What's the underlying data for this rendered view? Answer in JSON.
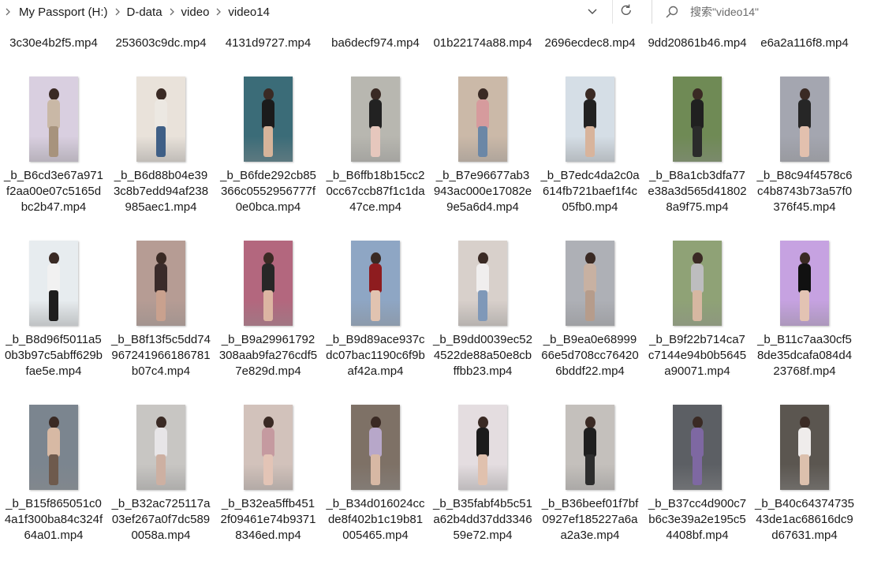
{
  "address_bar": {
    "crumbs": [
      "My Passport (H:)",
      "D-data",
      "video",
      "video14"
    ]
  },
  "search": {
    "placeholder": "搜索\"video14\""
  },
  "top_row": [
    "3c30e4b2f5.mp4",
    "253603c9dc.mp4",
    "4131d9727.mp4",
    "ba6decf974.mp4",
    "01b22174a88.mp4",
    "2696ecdec8.mp4",
    "9dd20861b46.mp4",
    "e6a2a116f8.mp4"
  ],
  "files": [
    {
      "name": "_b_B6cd3e67a971f2aa00e07c5165dbc2b47.mp4",
      "bg": "#d9cfe0",
      "body": "#c9b8a6",
      "legs": "#a7937d"
    },
    {
      "name": "_b_B6d88b04e393c8b7edd94af238985aec1.mp4",
      "bg": "#e9e2da",
      "body": "#ece8e2",
      "legs": "#3f5f86"
    },
    {
      "name": "_b_B6fde292cb85366c0552956777f0e0bca.mp4",
      "bg": "#3b6c78",
      "body": "#1b1b1b",
      "legs": "#d6b49a"
    },
    {
      "name": "_b_B6ffb18b15cc20cc67ccb87f1c1da47ce.mp4",
      "bg": "#b8b7b0",
      "body": "#222222",
      "legs": "#e6c7bd"
    },
    {
      "name": "_b_B7e96677ab3943ac000e17082e9e5a6d4.mp4",
      "bg": "#cbb9a8",
      "body": "#d69b9d",
      "legs": "#6b87a6"
    },
    {
      "name": "_b_B7edc4da2c0a614fb721baef1f4c05fb0.mp4",
      "bg": "#d5dee6",
      "body": "#222222",
      "legs": "#d8b49c"
    },
    {
      "name": "_b_B8a1cb3dfa77e38a3d565d418028a9f75.mp4",
      "bg": "#6f8a55",
      "body": "#202020",
      "legs": "#2b2b2b"
    },
    {
      "name": "_b_B8c94f4578c6c4b8743b73a57f0376f45.mp4",
      "bg": "#a4a6b0",
      "body": "#262626",
      "legs": "#e2c0ae"
    },
    {
      "name": "_b_B8d96f5011a50b3b97c5abff629bfae5e.mp4",
      "bg": "#e7ecef",
      "body": "#f1f1f1",
      "legs": "#1e1e1e"
    },
    {
      "name": "_b_B8f13f5c5dd74967241966186781b07c4.mp4",
      "bg": "#b69c94",
      "body": "#3a2b2a",
      "legs": "#c9a18e"
    },
    {
      "name": "_b_B9a29961792308aab9fa276cdf57e829d.mp4",
      "bg": "#b3677e",
      "body": "#272727",
      "legs": "#dcb5a2"
    },
    {
      "name": "_b_B9d89ace937cdc07bac1190c6f9baf42a.mp4",
      "bg": "#8ea6c4",
      "body": "#8e1c1f",
      "legs": "#e1c3b0"
    },
    {
      "name": "_b_B9dd0039ec524522de88a50e8cbffbb23.mp4",
      "bg": "#d8d0cb",
      "body": "#f0eeee",
      "legs": "#7f98b8"
    },
    {
      "name": "_b_B9ea0e6899966e5d708cc764206bddf22.mp4",
      "bg": "#aeb0b6",
      "body": "#c8b1a2",
      "legs": "#b69c8b"
    },
    {
      "name": "_b_B9f22b714ca7c7144e94b0b5645a90071.mp4",
      "bg": "#8fa276",
      "body": "#bdbdbf",
      "legs": "#d6b7a1"
    },
    {
      "name": "_b_B11c7aa30cf58de35dcafa084d423768f.mp4",
      "bg": "#c6a2e1",
      "body": "#111111",
      "legs": "#e3c3b3"
    },
    {
      "name": "_b_B15f865051c04a1f300ba84c324f64a01.mp4",
      "bg": "#7b858f",
      "body": "#d7b9a4",
      "legs": "#6e5a4d"
    },
    {
      "name": "_b_B32ac725117a03ef267a0f7dc5890058a.mp4",
      "bg": "#c8c6c3",
      "body": "#e7e5e7",
      "legs": "#cdb0a2"
    },
    {
      "name": "_b_B32ea5ffb4512f09461e74b93718346ed.mp4",
      "bg": "#d2c2bb",
      "body": "#c59aa0",
      "legs": "#e3c4b6"
    },
    {
      "name": "_b_B34d016024ccde8f402b1c19b81005465.mp4",
      "bg": "#7e7166",
      "body": "#b7a7c9",
      "legs": "#d7b8a4"
    },
    {
      "name": "_b_B35fabf4b5c51a62b4dd37dd334659e72.mp4",
      "bg": "#e4dde0",
      "body": "#1b1b1b",
      "legs": "#e0c1ae"
    },
    {
      "name": "_b_B36beef01f7bf0927ef185227a6aa2a3e.mp4",
      "bg": "#c4c0bc",
      "body": "#1f1f1f",
      "legs": "#2d2d2d"
    },
    {
      "name": "_b_B37cc4d900c7b6c3e39a2e195c54408bf.mp4",
      "bg": "#5c5f64",
      "body": "#7e68a2",
      "legs": "#7e68a2"
    },
    {
      "name": "_b_B40c6437473543de1ac68616dc9d67631.mp4",
      "bg": "#5b5650",
      "body": "#efeceb",
      "legs": "#dcc0ad"
    }
  ]
}
